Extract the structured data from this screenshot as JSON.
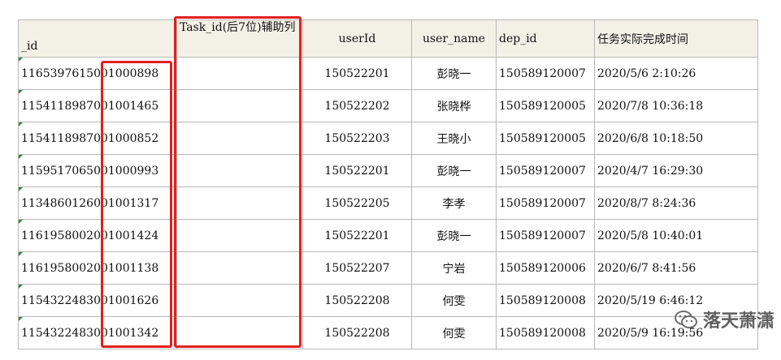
{
  "table": {
    "headers": {
      "id": "_id",
      "aux": "Task_id(后7位)辅助列",
      "user_id": "userId",
      "user_name": "user_name",
      "dep_id": "dep_id",
      "time": "任务实际完成时间"
    },
    "rows": [
      {
        "id": "116539761500",
        "id_tail": "1000898",
        "aux": "",
        "user_id": "150522201",
        "user_name": "彭晓一",
        "dep_id": "150589120007",
        "time": "2020/5/6  2:10:26"
      },
      {
        "id": "115411898700",
        "id_tail": "1001465",
        "aux": "",
        "user_id": "150522202",
        "user_name": "张晓桦",
        "dep_id": "150589120005",
        "time": "2020/7/8  10:36:18"
      },
      {
        "id": "115411898700",
        "id_tail": "1000852",
        "aux": "",
        "user_id": "150522203",
        "user_name": "王晓小",
        "dep_id": "150589120005",
        "time": "2020/6/8  10:18:50"
      },
      {
        "id": "115951706500",
        "id_tail": "1000993",
        "aux": "",
        "user_id": "150522201",
        "user_name": "彭晓一",
        "dep_id": "150589120007",
        "time": "2020/4/7  16:29:30"
      },
      {
        "id": "113486012600",
        "id_tail": "1001317",
        "aux": "",
        "user_id": "150522205",
        "user_name": "李孝",
        "dep_id": "150589120007",
        "time": "2020/8/7  8:24:36"
      },
      {
        "id": "116195800200",
        "id_tail": "1001424",
        "aux": "",
        "user_id": "150522201",
        "user_name": "彭晓一",
        "dep_id": "150589120007",
        "time": "2020/5/8  10:40:01"
      },
      {
        "id": "116195800200",
        "id_tail": "1001138",
        "aux": "",
        "user_id": "150522207",
        "user_name": "宁岩",
        "dep_id": "150589120006",
        "time": "2020/6/7  8:41:56"
      },
      {
        "id": "115432248300",
        "id_tail": "1001626",
        "aux": "",
        "user_id": "150522208",
        "user_name": "何雯",
        "dep_id": "150589120008",
        "time": "2020/5/19  6:46:12"
      },
      {
        "id": "115432248300",
        "id_tail": "1001342",
        "aux": "",
        "user_id": "150522208",
        "user_name": "何雯",
        "dep_id": "150589120008",
        "time": "2020/5/9  16:19:56"
      }
    ]
  },
  "watermark": {
    "text": "落天萧潇",
    "icon": "wechat-icon"
  },
  "colors": {
    "highlight": "#e3201b",
    "header_bg": "#f3f0e6",
    "error_triangle": "#2e8b3d"
  }
}
